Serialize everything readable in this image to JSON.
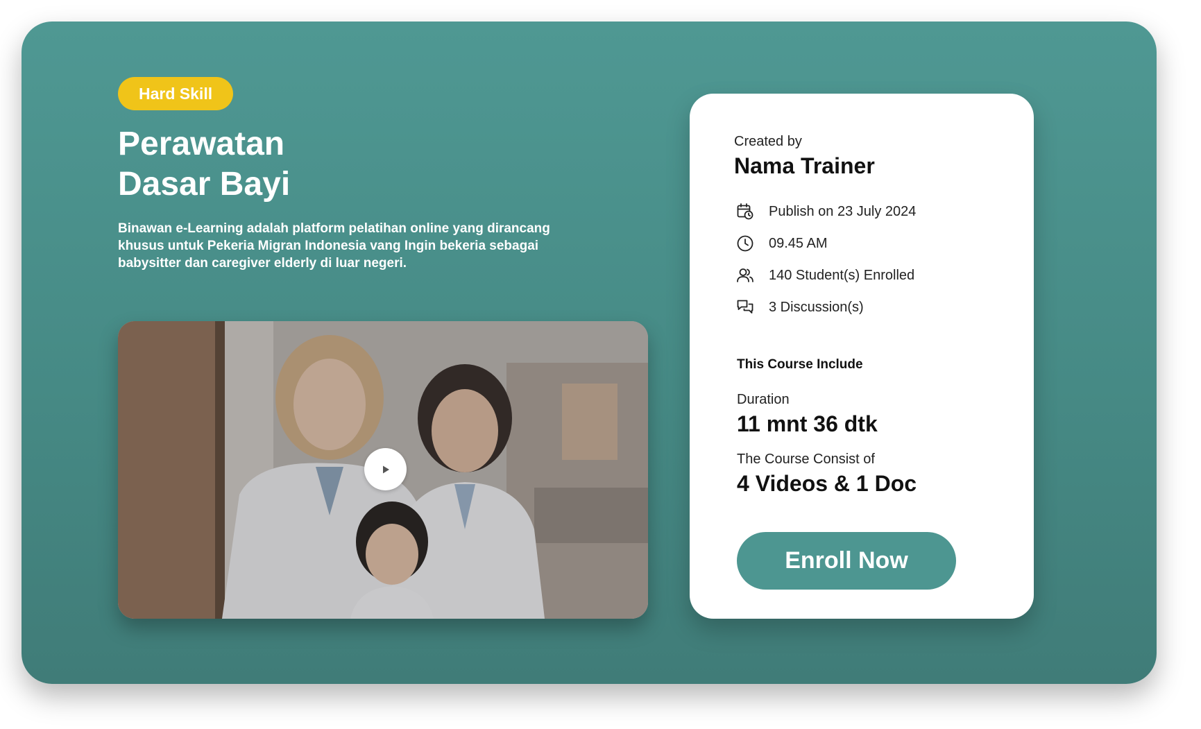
{
  "course": {
    "badge": "Hard Skill",
    "title_line1": "Perawatan",
    "title_line2": "Dasar Bayi",
    "description": "Binawan e-Learning adalah platform pelatihan online yang dirancang khusus untuk Pekeria Migran Indonesia vang Ingin bekeria sebagai babysitter dan caregiver elderly di luar negeri."
  },
  "video": {
    "play_icon": "play-icon"
  },
  "sidebar_card": {
    "created_by_label": "Created by",
    "trainer_name": "Nama Trainer",
    "meta": {
      "publish": "Publish on 23 July 2024",
      "time": "09.45 AM",
      "students": "140 Student(s) Enrolled",
      "discussions": "3 Discussion(s)"
    },
    "icons": {
      "publish": "calendar-clock-icon",
      "time": "clock-icon",
      "students": "users-icon",
      "discussions": "chat-bubbles-icon"
    },
    "include_heading": "This Course Include",
    "duration_label": "Duration",
    "duration_value": "11 mnt 36 dtk",
    "consist_label": "The Course Consist of",
    "consist_value": "4 Videos & 1 Doc",
    "enroll_label": "Enroll Now"
  },
  "colors": {
    "teal": "#4d9691",
    "badge_yellow": "#f0c419",
    "card_bg": "#ffffff"
  }
}
